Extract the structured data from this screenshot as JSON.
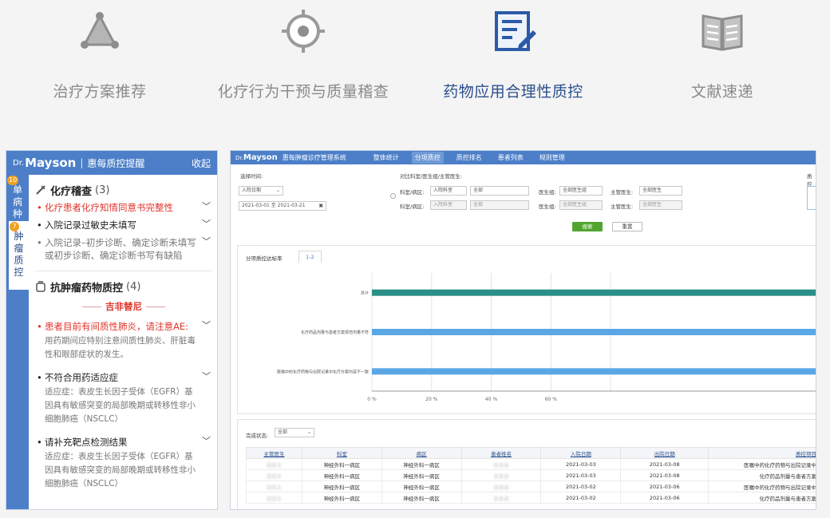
{
  "tabs": [
    {
      "label": "治疗方案推荐",
      "icon": "triangle-network-icon",
      "active": false
    },
    {
      "label": "化疗行为干预与质量稽查",
      "icon": "target-icon",
      "active": false
    },
    {
      "label": "药物应用合理性质控",
      "icon": "document-edit-icon",
      "active": true
    },
    {
      "label": "文献速递",
      "icon": "open-book-icon",
      "active": false
    }
  ],
  "left_panel": {
    "brand_prefix": "Dr.",
    "brand": "Mayson",
    "title": "惠每质控提醒",
    "collapse": "收起",
    "vertical_tabs": [
      {
        "label": "单\n病\n种",
        "badge": "10"
      },
      {
        "label": "肿\n瘤\n质\n控",
        "badge": "7"
      }
    ],
    "section1": {
      "title": "化疗稽查",
      "count": "(3)",
      "items": [
        {
          "text": "化疗患者化疗知情同意书完整性",
          "style": "red"
        },
        {
          "text": "入院记录过敏史未填写",
          "style": "normal"
        },
        {
          "text": "入院记录–初步诊断、确定诊断未填写或初步诊断、确定诊断书写有缺陷",
          "style": "gray"
        }
      ]
    },
    "section2": {
      "title": "抗肿瘤药物质控",
      "count": "(4)",
      "drug": "吉非替尼",
      "items": [
        {
          "text": "患者目前有间质性肺炎，请注意AE:",
          "desc": "用药期间应特别注意间质性肺炎、肝脏毒性和眼部症状的发生。",
          "style": "red"
        },
        {
          "text": "不符合用药适应症",
          "desc": "适应症：表皮生长因子受体（EGFR）基因具有敏感突变的局部晚期或转移性非小细胞肺癌（NSCLC）",
          "style": "normal"
        },
        {
          "text": "请补充靶点检测结果",
          "desc": "适应症：表皮生长因子受体（EGFR）基因具有敏感突变的局部晚期或转移性非小细胞肺癌（NSCLC）",
          "style": "normal"
        }
      ]
    }
  },
  "system": {
    "brand_prefix": "Dr.",
    "brand": "Mayson",
    "title": "惠每肿瘤诊疗管理系统",
    "nav": [
      {
        "label": "整体统计",
        "active": false
      },
      {
        "label": "分项质控",
        "active": true
      },
      {
        "label": "质控排名",
        "active": false
      },
      {
        "label": "患者列表",
        "active": false
      },
      {
        "label": "规则管理",
        "active": false
      }
    ],
    "filters": {
      "time_label": "选择时间:",
      "time_type": "入院日期",
      "date_range": "2021-03-01 至 2021-03-21",
      "compare_label": "对比科室/医生组/主管医生:",
      "row1": {
        "dept_label": "科室/病区:",
        "dept_type": "入院科室",
        "dept_value": "全部",
        "group_label": "医生组:",
        "group_value": "全部医生组",
        "doctor_label": "主管医生:",
        "doctor_value": "全部医生"
      },
      "row2": {
        "dept_label": "科室/病区:",
        "dept_type": "入院科室",
        "dept_value": "全部",
        "group_label": "医生组:",
        "group_value": "全部医生组",
        "doctor_label": "主管医生:",
        "doctor_value": "全部医生"
      },
      "right_label": "质控",
      "search": "搜索",
      "reset": "重置"
    },
    "chart_tabs": [
      "分项质控达标率",
      "1-2"
    ],
    "table": {
      "status_label": "完成状态:",
      "status_value": "全部",
      "columns": [
        "主管医生",
        "科室",
        "病区",
        "患者姓名",
        "入院日期",
        "出院日期",
        "质控项目"
      ],
      "rows": [
        {
          "doctor": "某医生",
          "dept": "神经外科一病区",
          "ward": "神经外科一病区",
          "patient": "某患者",
          "admit": "2021-03-03",
          "discharge": "2021-03-08",
          "item": "医嘱中的化疗药物与出院记录中"
        },
        {
          "doctor": "某医生",
          "dept": "神经外科一病区",
          "ward": "神经外科一病区",
          "patient": "某患者",
          "admit": "2021-03-03",
          "discharge": "2021-03-08",
          "item": "化疗药品剂量与患者方案"
        },
        {
          "doctor": "某医生",
          "dept": "神经外科一病区",
          "ward": "神经外科一病区",
          "patient": "某患者",
          "admit": "2021-03-02",
          "discharge": "2021-03-06",
          "item": "医嘱中的化疗药物与出院记录中"
        },
        {
          "doctor": "某医生",
          "dept": "神经外科一病区",
          "ward": "神经外科一病区",
          "patient": "某患者",
          "admit": "2021-03-02",
          "discharge": "2021-03-06",
          "item": "化疗药品剂量与患者方案"
        }
      ]
    }
  },
  "chart_data": {
    "type": "bar",
    "orientation": "horizontal",
    "categories": [
      "总计",
      "化疗药品剂量与患者方案规范剂量不符",
      "医嘱中的化疗药物与出院记录中化疗方案内容不一致"
    ],
    "values": [
      100,
      100,
      100
    ],
    "colors": [
      "#2a8f88",
      "#5aa7e6",
      "#5aa7e6"
    ],
    "xlim": [
      0,
      100
    ],
    "x_ticks": [
      "0 %",
      "20 %",
      "40 %",
      "60 %"
    ],
    "grid": true
  }
}
